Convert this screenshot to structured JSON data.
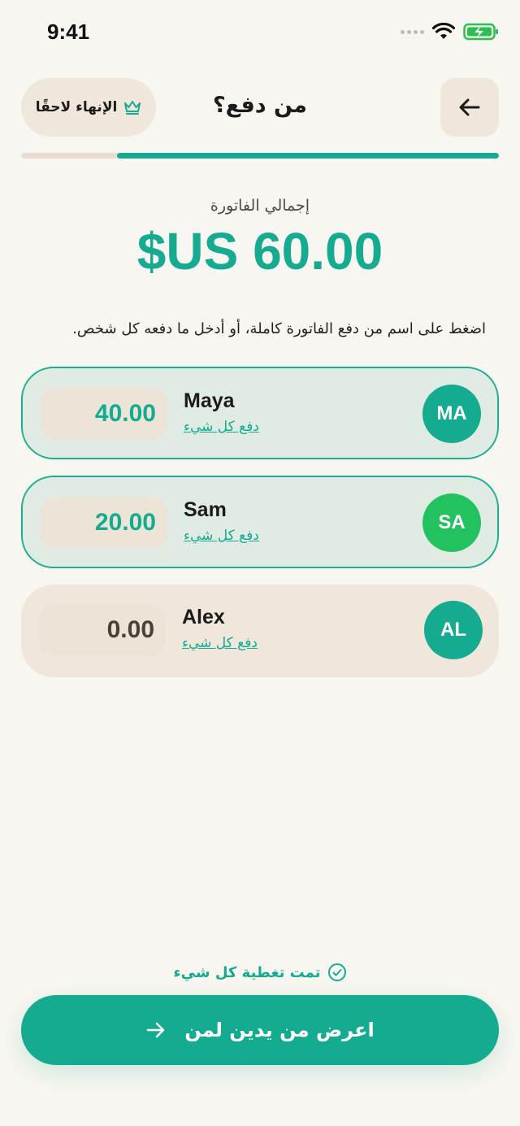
{
  "status_bar": {
    "time": "9:41"
  },
  "header": {
    "title": "من دفع؟",
    "finish_later_label": "الإنهاء لاحقًا",
    "finish_icon": "crown-icon",
    "back_icon": "arrow-left-icon"
  },
  "progress": {
    "fraction": 0.8
  },
  "bill": {
    "total_label": "إجمالي الفاتورة",
    "total_amount": "$US 60.00"
  },
  "instruction": "اضغط على اسم من دفع الفاتورة كاملة، أو أدخل ما دفعه كل شخص.",
  "people": [
    {
      "initials": "MA",
      "name": "Maya",
      "pay_all_label": "دفع كل شيء",
      "amount": "40.00",
      "avatar_color": "#14ab91",
      "selected": true
    },
    {
      "initials": "SA",
      "name": "Sam",
      "pay_all_label": "دفع كل شيء",
      "amount": "20.00",
      "avatar_color": "#22c35e",
      "selected": true
    },
    {
      "initials": "AL",
      "name": "Alex",
      "pay_all_label": "دفع كل شيء",
      "amount": "0.00",
      "avatar_color": "#14ab91",
      "selected": false
    }
  ],
  "footer": {
    "covered_label": "تمت تغطية كل شيء",
    "cta_label": "اعرض من يدين لمن"
  },
  "colors": {
    "accent": "#14ab91",
    "background": "#f8f6f0",
    "card": "#efe7dc"
  }
}
